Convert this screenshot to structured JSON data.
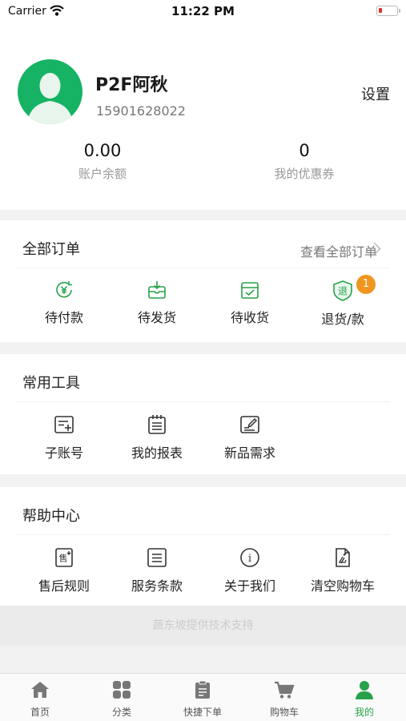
{
  "status_bar": {
    "carrier": "Carrier",
    "time": "11:22 PM"
  },
  "profile": {
    "name": "P2F阿秋",
    "phone": "15901628022",
    "settings_label": "设置",
    "balance": {
      "value": "0.00",
      "label": "账户余额"
    },
    "coupons": {
      "value": "0",
      "label": "我的优惠券"
    }
  },
  "orders": {
    "title": "全部订单",
    "view_all": "查看全部订单",
    "items": [
      {
        "label": "待付款",
        "icon": "yuan-refresh-icon"
      },
      {
        "label": "待发货",
        "icon": "package-icon"
      },
      {
        "label": "待收货",
        "icon": "delivery-box-icon"
      },
      {
        "label": "退货/款",
        "icon": "return-shield-icon",
        "icon_char": "退",
        "badge": "1"
      }
    ],
    "accent_color": "#27a24a"
  },
  "tools": {
    "title": "常用工具",
    "items": [
      {
        "label": "子账号",
        "icon": "add-list-icon"
      },
      {
        "label": "我的报表",
        "icon": "report-icon"
      },
      {
        "label": "新品需求",
        "icon": "edit-note-icon"
      }
    ]
  },
  "help": {
    "title": "帮助中心",
    "items": [
      {
        "label": "售后规则",
        "icon": "after-sales-icon",
        "icon_char": "售"
      },
      {
        "label": "服务条款",
        "icon": "terms-icon"
      },
      {
        "label": "关于我们",
        "icon": "info-icon",
        "icon_char": "i"
      },
      {
        "label": "清空购物车",
        "icon": "clear-cart-icon"
      }
    ]
  },
  "footer_note": "蔬东坡提供技术支持",
  "tabbar": {
    "active_color": "#27a24a",
    "tabs": [
      {
        "label": "首页",
        "icon": "home-icon"
      },
      {
        "label": "分类",
        "icon": "category-grid-icon"
      },
      {
        "label": "快捷下单",
        "icon": "clipboard-icon"
      },
      {
        "label": "购物车",
        "icon": "cart-icon"
      },
      {
        "label": "我的",
        "icon": "user-icon",
        "active": true
      }
    ]
  }
}
